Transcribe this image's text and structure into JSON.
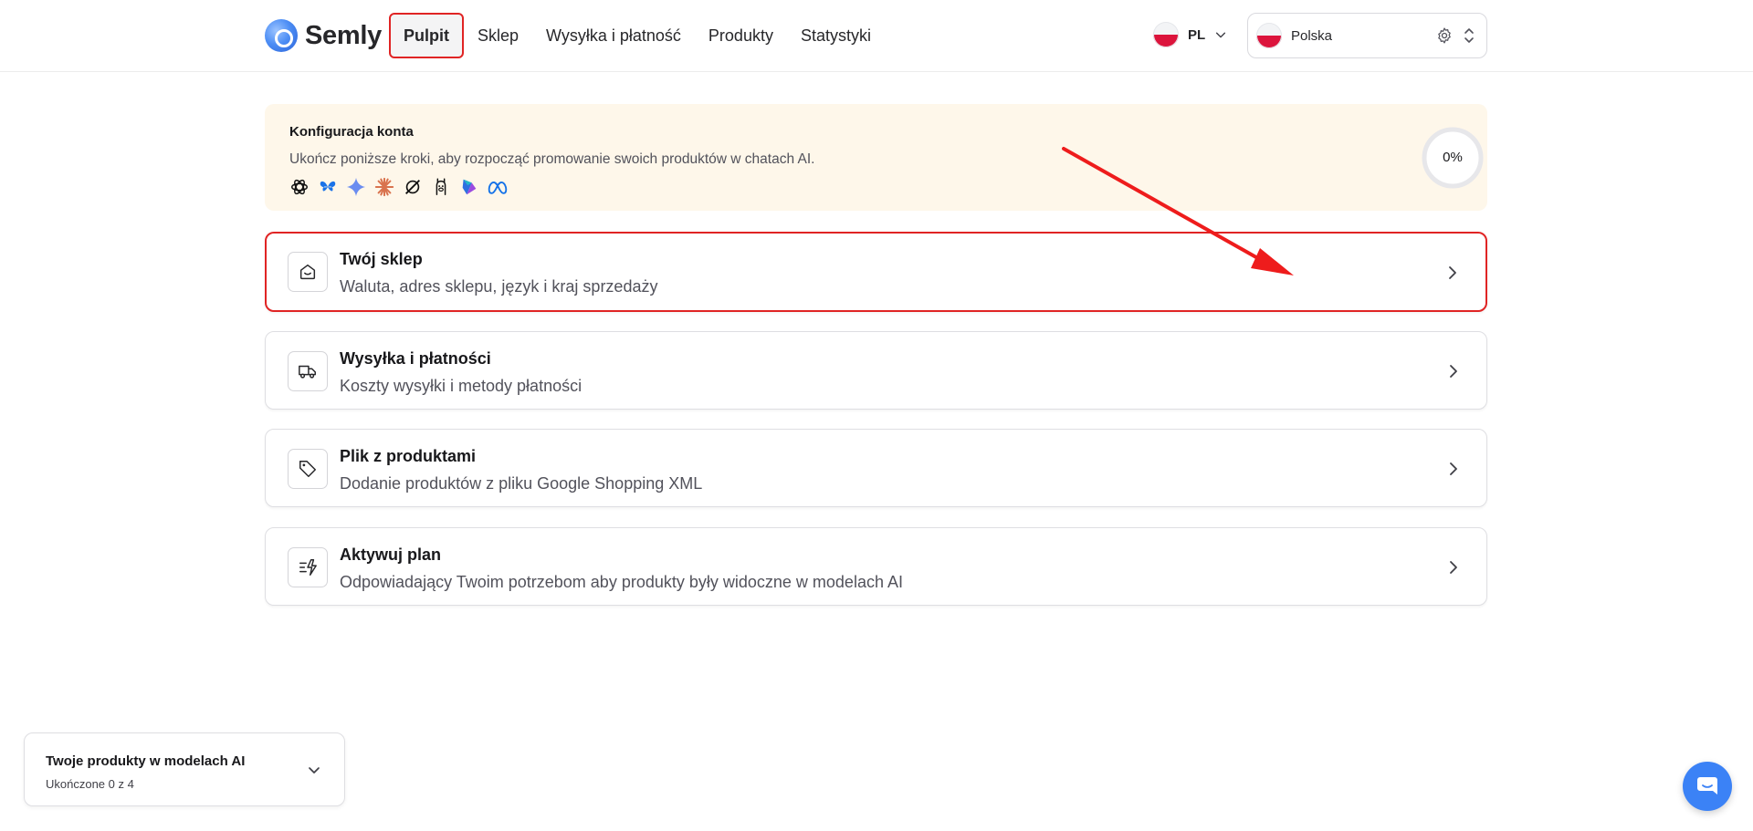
{
  "app": {
    "name": "Semly"
  },
  "nav": {
    "items": [
      {
        "label": "Pulpit"
      },
      {
        "label": "Sklep"
      },
      {
        "label": "Wysyłka i płatność"
      },
      {
        "label": "Produkty"
      },
      {
        "label": "Statystyki"
      }
    ]
  },
  "language": {
    "code": "PL"
  },
  "country": {
    "name": "Polska"
  },
  "setup": {
    "title": "Konfiguracja konta",
    "description": "Ukończ poniższe kroki, aby rozpocząć promowanie swoich produktów w chatach AI.",
    "progress_label": "0%",
    "progress_fraction": 0,
    "ai_icons": [
      "chatgpt-icon",
      "perplexity-icon",
      "gemini-icon",
      "claude-icon",
      "grok-icon",
      "ollama-icon",
      "copilot-icon",
      "meta-ai-icon"
    ]
  },
  "steps": [
    {
      "title": "Twój sklep",
      "subtitle": "Waluta, adres sklepu, język i kraj sprzedaży",
      "icon": "store-icon"
    },
    {
      "title": "Wysyłka i płatności",
      "subtitle": "Koszty wysyłki i metody płatności",
      "icon": "truck-icon"
    },
    {
      "title": "Plik z produktami",
      "subtitle": "Dodanie produktów z pliku Google Shopping XML",
      "icon": "tag-icon"
    },
    {
      "title": "Aktywuj plan",
      "subtitle": "Odpowiadający Twoim potrzebom aby produkty były widoczne w modelach AI",
      "icon": "plan-icon"
    }
  ],
  "widget": {
    "title": "Twoje produkty w modelach AI",
    "subtitle": "Ukończone 0 z 4"
  },
  "colors": {
    "accent": "#3b82f6",
    "banner": "#fef7ea",
    "highlight": "#e02424"
  }
}
